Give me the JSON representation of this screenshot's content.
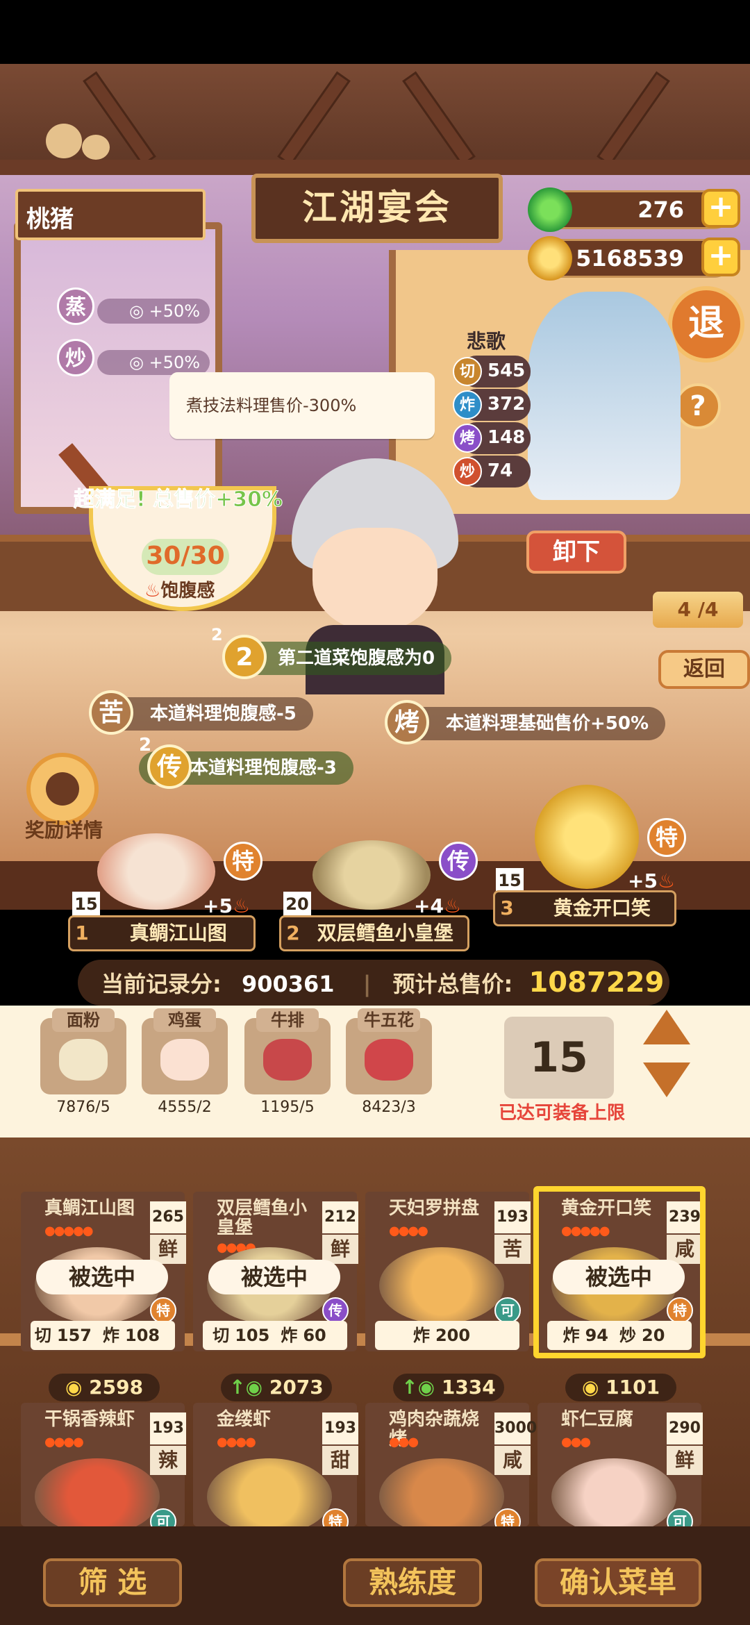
{
  "player_name": "桃猪",
  "banner_title": "江湖宴会",
  "currency": {
    "jade": "276",
    "coins": "5168539"
  },
  "exit_label": "退",
  "help_label": "?",
  "technique_bonuses": [
    {
      "tech": "蒸",
      "bonus": "+50%"
    },
    {
      "tech": "炒",
      "bonus": "+50%"
    }
  ],
  "tooltip": "煮技法料理售价-300%",
  "chef": {
    "name": "悲歌",
    "stats": [
      {
        "tech": "切",
        "value": "545",
        "color": "#c8862e"
      },
      {
        "tech": "炸",
        "value": "372",
        "color": "#2e8ec8"
      },
      {
        "tech": "烤",
        "value": "148",
        "color": "#8a4ec8"
      },
      {
        "tech": "炒",
        "value": "74",
        "color": "#d0502e"
      }
    ]
  },
  "satisfaction": {
    "label": "超满足!  总售价+30%",
    "fullness": "30/30",
    "fullness_label": "饱腹感"
  },
  "unload_label": "卸下",
  "page_indicator": "4 /4",
  "back_label": "返回",
  "effects": [
    {
      "icon": "2",
      "sup": "2",
      "text": "第二道菜饱腹感为0",
      "color": "#e0a22e"
    },
    {
      "icon": "苦",
      "sup": "",
      "text": "本道料理饱腹感-5",
      "color": "#b07a4a"
    },
    {
      "icon": "烤",
      "sup": "",
      "text": "本道料理基础售价+50%",
      "color": "#b07a4a"
    },
    {
      "icon": "传",
      "sup": "2",
      "text": "本道料理饱腹感-3",
      "color": "#e0a22e"
    }
  ],
  "reward_label": "奖励详情",
  "dish_slots": [
    {
      "slot": "1",
      "name": "真鲷江山图",
      "count": "15",
      "bonus": "+5",
      "grade": "特",
      "grade_color": "#e0822e"
    },
    {
      "slot": "2",
      "name": "双层鳕鱼小皇堡",
      "count": "20",
      "bonus": "+4",
      "grade": "传",
      "grade_color": "#8a4ec8"
    },
    {
      "slot": "3",
      "name": "黄金开口笑",
      "count": "15",
      "bonus": "+5",
      "grade": "特",
      "grade_color": "#e0822e"
    }
  ],
  "score": {
    "record_label": "当前记录分:",
    "record_value": "900361",
    "total_label": "预计总售价:",
    "total_value": "1087229"
  },
  "ingredients": [
    {
      "name": "面粉",
      "count": "7876/5",
      "color": "#f2e6c8"
    },
    {
      "name": "鸡蛋",
      "count": "4555/2",
      "color": "#fbe1d2"
    },
    {
      "name": "牛排",
      "count": "1195/5",
      "color": "#c8484a"
    },
    {
      "name": "牛五花",
      "count": "8423/3",
      "color": "#d0464a"
    }
  ],
  "quantity": "15",
  "limit_label": "已达可装备上限",
  "menu": [
    {
      "name": "真鲷江山图",
      "price": "265",
      "flavor": "鲜",
      "flames": 5,
      "selected": "被选中",
      "grade": "特",
      "grade_color": "#e0822e",
      "stats": [
        [
          "切",
          "157"
        ],
        [
          "炸",
          "108"
        ]
      ],
      "coin": "2598",
      "up": false,
      "img": "#f1c9a8"
    },
    {
      "name": "双层鳕鱼小皇堡",
      "price": "212",
      "flavor": "鲜",
      "flames": 4,
      "selected": "被选中",
      "grade": "传",
      "grade_color": "#8a4ec8",
      "stats": [
        [
          "切",
          "105"
        ],
        [
          "炸",
          "60"
        ]
      ],
      "coin": "2073",
      "up": true,
      "img": "#e5d09a"
    },
    {
      "name": "天妇罗拼盘",
      "price": "193",
      "flavor": "苦",
      "flames": 4,
      "selected": "",
      "grade": "可",
      "grade_color": "#3a9a88",
      "stats": [
        [
          "炸",
          "200"
        ]
      ],
      "coin": "1334",
      "up": true,
      "img": "#f2b65c"
    },
    {
      "name": "黄金开口笑",
      "price": "239",
      "flavor": "咸",
      "flames": 5,
      "selected": "被选中",
      "grade": "特",
      "grade_color": "#e0822e",
      "stats": [
        [
          "炸",
          "94"
        ],
        [
          "炒",
          "20"
        ]
      ],
      "coin": "1101",
      "up": false,
      "img": "#e3b24a"
    },
    {
      "name": "干锅香辣虾",
      "price": "193",
      "flavor": "辣",
      "flames": 4,
      "selected": "",
      "grade": "可",
      "grade_color": "#3a9a88",
      "stats": [],
      "coin": "",
      "up": false,
      "img": "#e2583a"
    },
    {
      "name": "金缕虾",
      "price": "193",
      "flavor": "甜",
      "flames": 4,
      "selected": "",
      "grade": "特",
      "grade_color": "#e0822e",
      "stats": [],
      "coin": "",
      "up": false,
      "img": "#f0c060"
    },
    {
      "name": "鸡肉杂蔬烧烤",
      "price": "3000",
      "flavor": "咸",
      "flames": 3,
      "selected": "",
      "grade": "特",
      "grade_color": "#e0822e",
      "stats": [],
      "coin": "",
      "up": false,
      "img": "#d8884a"
    },
    {
      "name": "虾仁豆腐",
      "price": "290",
      "flavor": "鲜",
      "flames": 3,
      "selected": "",
      "grade": "可",
      "grade_color": "#3a9a88",
      "stats": [],
      "coin": "",
      "up": false,
      "img": "#f6d2c4"
    }
  ],
  "bottom_buttons": {
    "filter": "筛  选",
    "proficiency": "熟练度",
    "confirm": "确认菜单"
  }
}
